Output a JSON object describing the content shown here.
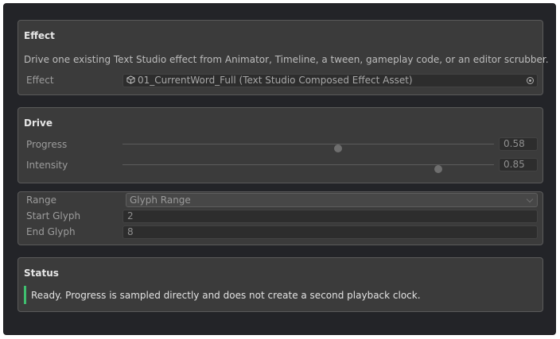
{
  "effect_panel": {
    "title": "Effect",
    "description": "Drive one existing Text Studio effect from Animator, Timeline, a tween, gameplay code, or an editor scrubber.",
    "effect_label": "Effect",
    "effect_value": "01_CurrentWord_Full (Text Studio Composed Effect Asset)",
    "asset_icon": "asset-cube-icon",
    "picker_icon": "object-picker-icon"
  },
  "drive_panel": {
    "title": "Drive",
    "progress": {
      "label": "Progress",
      "value": 0.58,
      "display": "0.58"
    },
    "intensity": {
      "label": "Intensity",
      "value": 0.85,
      "display": "0.85"
    }
  },
  "range_panel": {
    "range_label": "Range",
    "range_value": "Glyph Range",
    "start_label": "Start Glyph",
    "start_value": "2",
    "end_label": "End Glyph",
    "end_value": "8"
  },
  "status_panel": {
    "title": "Status",
    "message": "Ready. Progress is sampled directly and does not create a second playback clock.",
    "accent_color": "#3fbf6f"
  }
}
